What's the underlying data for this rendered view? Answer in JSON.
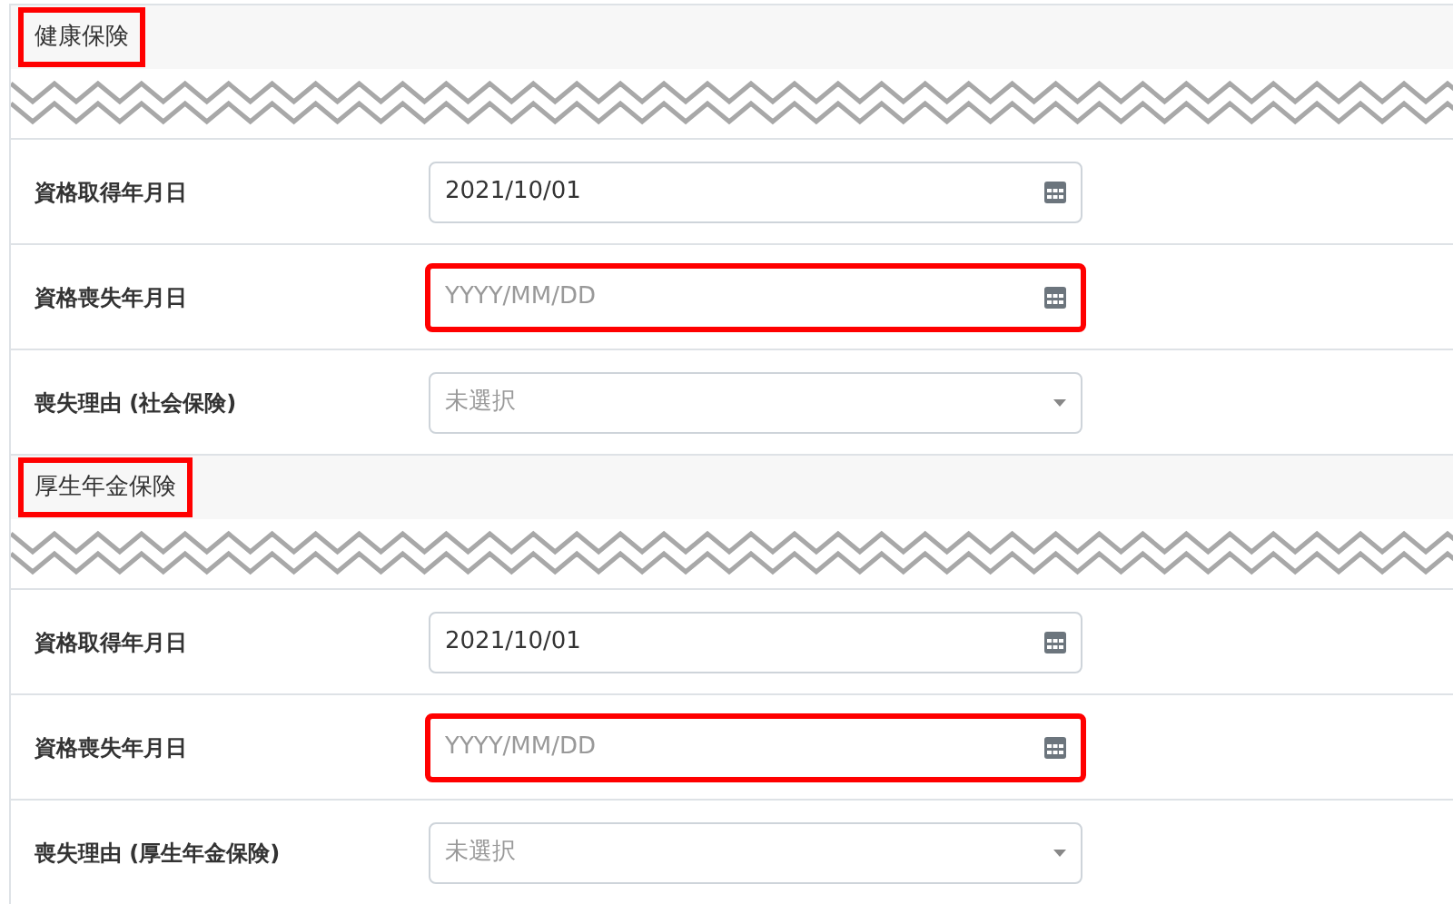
{
  "sections": [
    {
      "title": "健康保険",
      "highlighted": true,
      "rows": [
        {
          "label": "資格取得年月日",
          "kind": "date",
          "value": "2021/10/01",
          "highlighted": false
        },
        {
          "label": "資格喪失年月日",
          "kind": "date",
          "placeholder": "YYYY/MM/DD",
          "highlighted": true
        },
        {
          "label": "喪失理由 (社会保険)",
          "kind": "select",
          "placeholder": "未選択",
          "highlighted": false
        }
      ]
    },
    {
      "title": "厚生年金保険",
      "highlighted": true,
      "rows": [
        {
          "label": "資格取得年月日",
          "kind": "date",
          "value": "2021/10/01",
          "highlighted": false
        },
        {
          "label": "資格喪失年月日",
          "kind": "date",
          "placeholder": "YYYY/MM/DD",
          "highlighted": true
        },
        {
          "label": "喪失理由 (厚生年金保険)",
          "kind": "select",
          "placeholder": "未選択",
          "highlighted": false
        }
      ]
    }
  ]
}
